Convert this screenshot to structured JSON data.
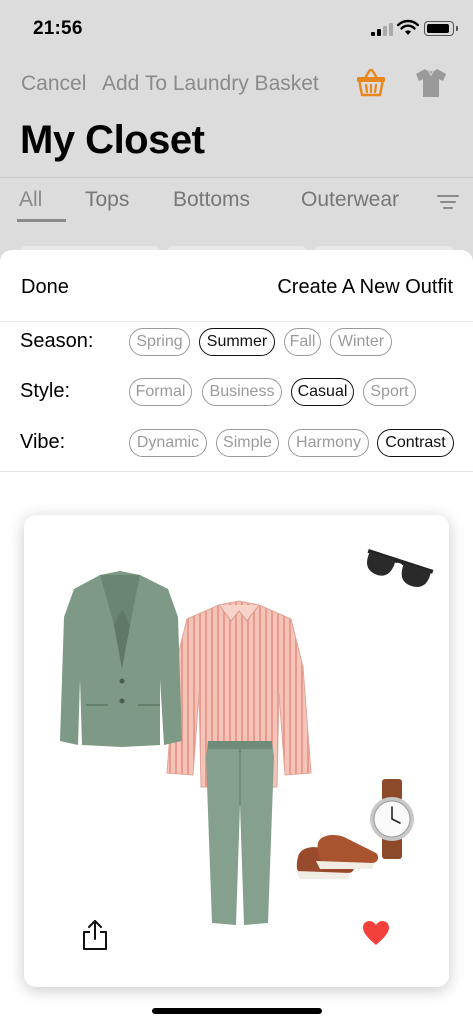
{
  "status_bar": {
    "time": "21:56"
  },
  "nav": {
    "cancel_label": "Cancel",
    "laundry_label": "Add To Laundry Basket",
    "basket_icon": "basket-icon",
    "shirt_icon": "shirt-icon",
    "accent_color": "#E8871E"
  },
  "page": {
    "title": "My Closet"
  },
  "tabs": [
    {
      "label": "All",
      "active": true
    },
    {
      "label": "Tops",
      "active": false
    },
    {
      "label": "Bottoms",
      "active": false
    },
    {
      "label": "Outerwear",
      "active": false
    }
  ],
  "sheet": {
    "done_label": "Done",
    "create_label": "Create A New Outfit",
    "attributes": [
      {
        "label": "Season:",
        "options": [
          "Spring",
          "Summer",
          "Fall",
          "Winter"
        ],
        "selected": "Summer"
      },
      {
        "label": "Style:",
        "options": [
          "Formal",
          "Business",
          "Casual",
          "Sport"
        ],
        "selected": "Casual"
      },
      {
        "label": "Vibe:",
        "options": [
          "Dynamic",
          "Simple",
          "Harmony",
          "Contrast"
        ],
        "selected": "Contrast"
      }
    ]
  },
  "outfit": {
    "items": [
      "green-blazer",
      "pink-striped-shirt",
      "green-trousers",
      "sunglasses",
      "watch",
      "brown-brogues"
    ],
    "favorite": true,
    "heart_color": "#F4403A"
  }
}
